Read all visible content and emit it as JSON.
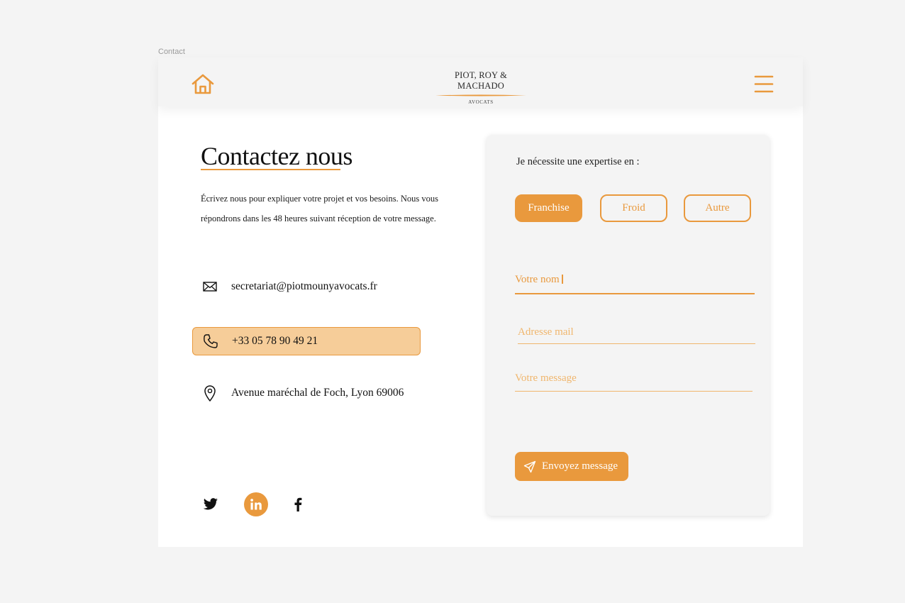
{
  "canvas": {
    "frame_label": "Contact"
  },
  "header": {
    "logo_name": "PIOT, ROY & MACHADO",
    "logo_subtitle": "AVOCATS",
    "home_icon": "home-icon",
    "menu_icon": "hamburger-menu-icon"
  },
  "contact": {
    "title": "Contactez nous",
    "intro": "Écrivez nous pour expliquer votre projet et vos besoins. Nous vous répondrons dans les 48 heures suivant réception de votre message.",
    "email": "secretariat@piotmounyavocats.fr",
    "phone": "+33 05 78 90 49 21",
    "address": "Avenue maréchal de Foch, Lyon 69006",
    "socials": [
      "twitter-icon",
      "linkedin-icon",
      "facebook-icon"
    ]
  },
  "form": {
    "expertise_label": "Je nécessite une expertise en :",
    "options": [
      "Franchise",
      "Froid",
      "Autre"
    ],
    "selected_option": "Franchise",
    "name_value": "Votre nom",
    "email_placeholder": "Adresse mail",
    "message_placeholder": "Votre message",
    "submit_label": "Envoyez message"
  },
  "colors": {
    "accent": "#e9993d",
    "accent_light": "#f6cd99",
    "placeholder": "#f0b66d",
    "panel": "#f4f4f4"
  }
}
